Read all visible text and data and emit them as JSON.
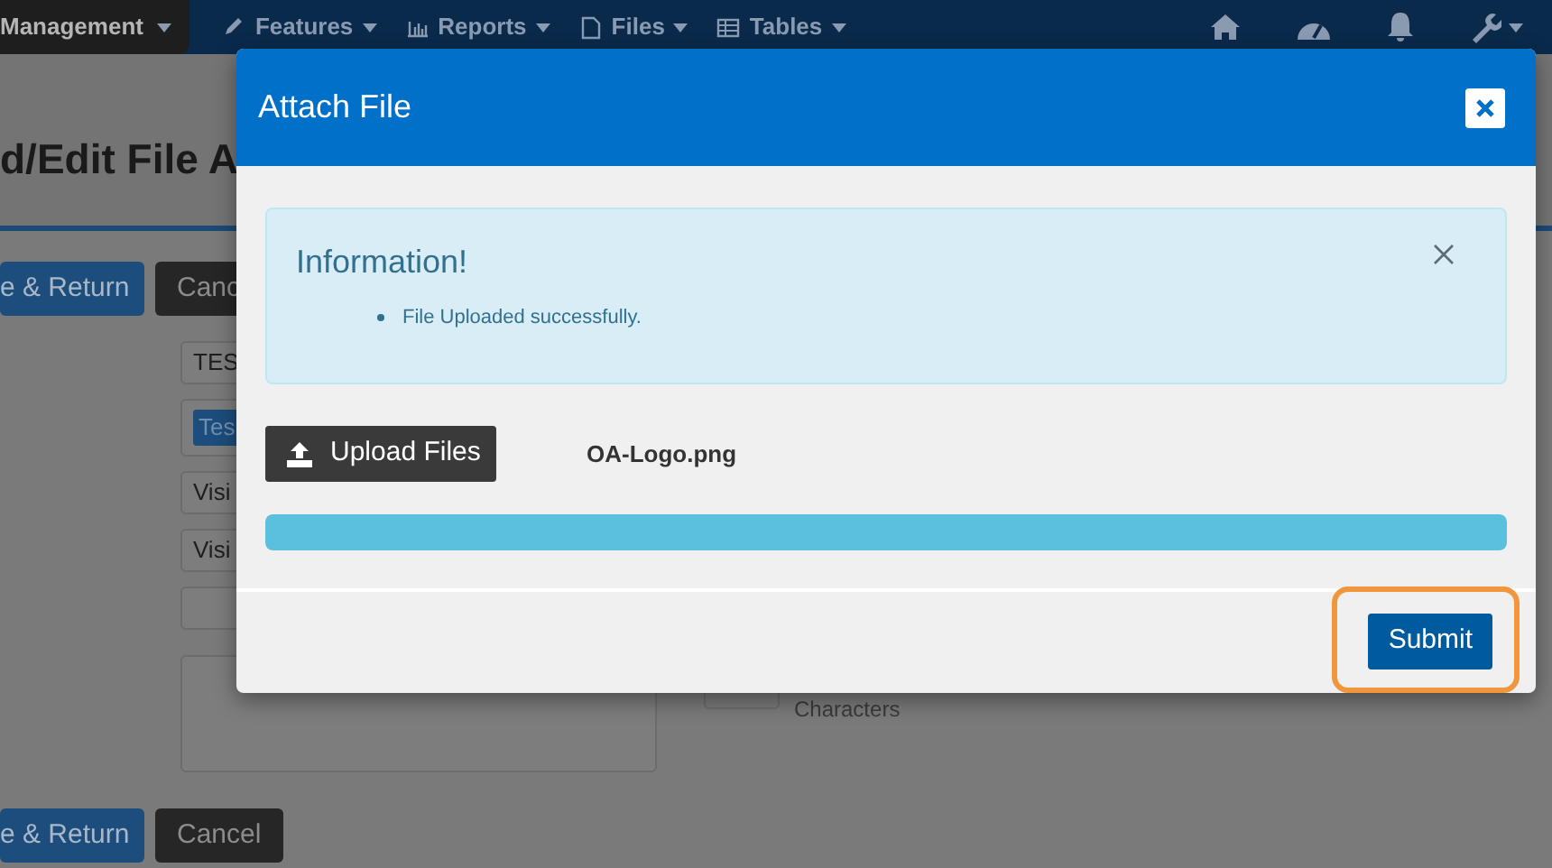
{
  "navbar": {
    "menus": [
      {
        "label": "Management",
        "selected": true
      },
      {
        "label": "Features",
        "selected": false
      },
      {
        "label": "Reports",
        "selected": false
      },
      {
        "label": "Files",
        "selected": false
      },
      {
        "label": "Tables",
        "selected": false
      }
    ]
  },
  "page": {
    "title": "d/Edit File A",
    "top_buttons": [
      {
        "label": "e & Return",
        "kind": "primary"
      },
      {
        "label": "Canc",
        "kind": "dark"
      }
    ],
    "fields": [
      {
        "kind": "text",
        "value": "TES"
      },
      {
        "kind": "tag",
        "value": "Tes"
      },
      {
        "kind": "text",
        "value": "Visi"
      },
      {
        "kind": "text",
        "value": "Visi"
      },
      {
        "kind": "empty"
      }
    ],
    "counter_label": "Characters",
    "bottom_buttons": [
      {
        "label": "e & Return",
        "kind": "primary"
      },
      {
        "label": "Cancel",
        "kind": "dark"
      }
    ]
  },
  "modal": {
    "title": "Attach File",
    "alert": {
      "heading": "Information!",
      "items": [
        "File Uploaded successfully."
      ]
    },
    "upload_button": "Upload Files",
    "file_name": "OA-Logo.png",
    "progress": {
      "level": 1
    },
    "submit_button": {
      "label": "Submit",
      "highlighted": true
    }
  }
}
